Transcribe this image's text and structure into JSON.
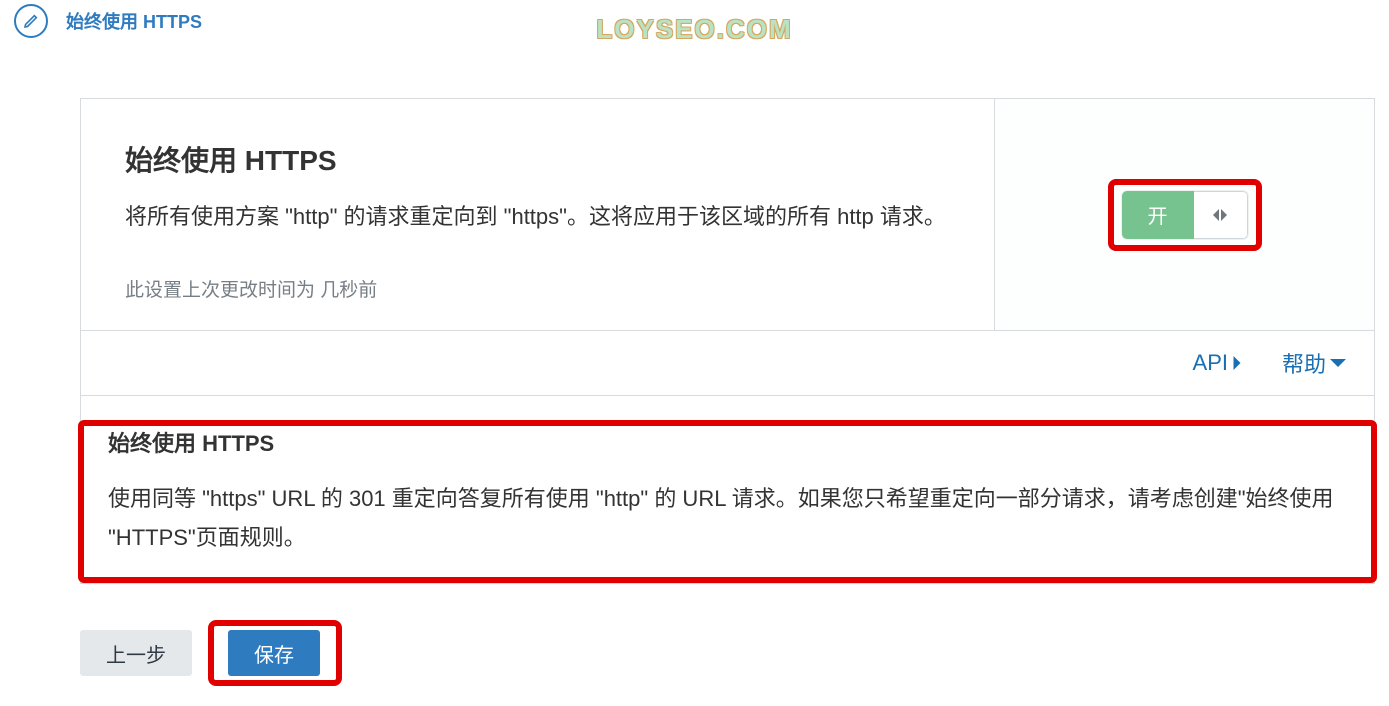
{
  "watermark": "LOYSEO.COM",
  "header": {
    "section_title": "始终使用 HTTPS"
  },
  "card": {
    "title": "始终使用 HTTPS",
    "description": "将所有使用方案 \"http\" 的请求重定向到 \"https\"。这将应用于该区域的所有 http 请求。",
    "meta": "此设置上次更改时间为 几秒前",
    "toggle_label": "开"
  },
  "footer_links": {
    "api": "API",
    "help": "帮助"
  },
  "help": {
    "title": "始终使用 HTTPS",
    "body": "使用同等 \"https\" URL 的 301 重定向答复所有使用 \"http\" 的 URL 请求。如果您只希望重定向一部分请求，请考虑创建\"始终使用 \"HTTPS\"页面规则。"
  },
  "buttons": {
    "back": "上一步",
    "save": "保存"
  }
}
